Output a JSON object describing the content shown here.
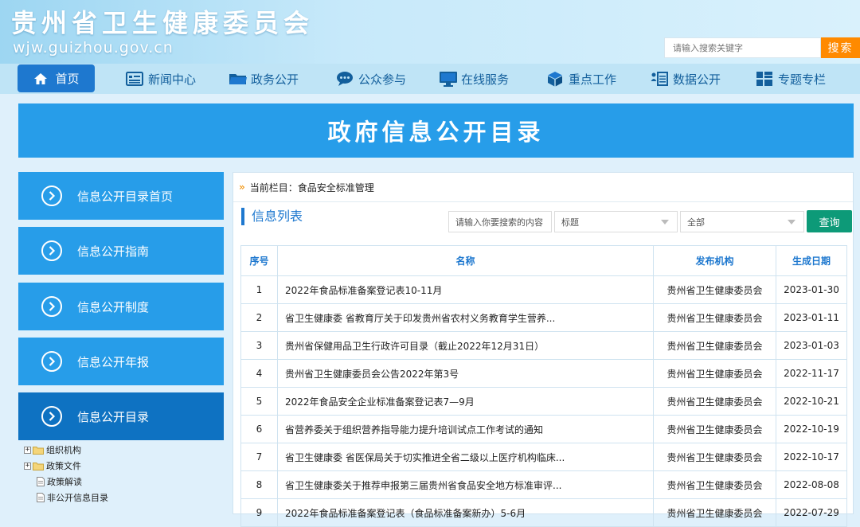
{
  "header": {
    "site_title": "贵州省卫生健康委员会",
    "site_domain": "wjw.guizhou.gov.cn",
    "search_placeholder": "请输入搜索关键字",
    "search_button": "搜索"
  },
  "nav": {
    "items": [
      {
        "label": "首页",
        "icon": "home-icon"
      },
      {
        "label": "新闻中心",
        "icon": "news-icon"
      },
      {
        "label": "政务公开",
        "icon": "folder-icon"
      },
      {
        "label": "公众参与",
        "icon": "chat-icon"
      },
      {
        "label": "在线服务",
        "icon": "monitor-icon"
      },
      {
        "label": "重点工作",
        "icon": "cube-icon"
      },
      {
        "label": "数据公开",
        "icon": "data-list-icon"
      },
      {
        "label": "专题专栏",
        "icon": "grid-icon"
      }
    ]
  },
  "page_title": "政府信息公开目录",
  "sidebar": {
    "items": [
      {
        "label": "信息公开目录首页"
      },
      {
        "label": "信息公开指南"
      },
      {
        "label": "信息公开制度"
      },
      {
        "label": "信息公开年报"
      },
      {
        "label": "信息公开目录"
      }
    ],
    "tree": [
      {
        "label": "组织机构",
        "type": "folder"
      },
      {
        "label": "政策文件",
        "type": "folder"
      },
      {
        "label": "政策解读",
        "type": "doc"
      },
      {
        "label": "非公开信息目录",
        "type": "doc"
      }
    ]
  },
  "content": {
    "breadcrumb_label": "当前栏目：食品安全标准管理",
    "list_title": "信息列表",
    "search_placeholder": "请输入你要搜索的内容",
    "field_select": "标题",
    "scope_select": "全部",
    "query_button": "查询",
    "columns": [
      "序号",
      "名称",
      "发布机构",
      "生成日期"
    ],
    "rows": [
      {
        "num": "1",
        "name": "2022年食品标准备案登记表10-11月",
        "org": "贵州省卫生健康委员会",
        "date": "2023-01-30"
      },
      {
        "num": "2",
        "name": "省卫生健康委 省教育厅关于印发贵州省农村义务教育学生营养...",
        "org": "贵州省卫生健康委员会",
        "date": "2023-01-11"
      },
      {
        "num": "3",
        "name": "贵州省保健用品卫生行政许可目录（截止2022年12月31日）",
        "org": "贵州省卫生健康委员会",
        "date": "2023-01-03"
      },
      {
        "num": "4",
        "name": "贵州省卫生健康委员会公告2022年第3号",
        "org": "贵州省卫生健康委员会",
        "date": "2022-11-17"
      },
      {
        "num": "5",
        "name": "2022年食品安全企业标准备案登记表7—9月",
        "org": "贵州省卫生健康委员会",
        "date": "2022-10-21"
      },
      {
        "num": "6",
        "name": "省营养委关于组织营养指导能力提升培训试点工作考试的通知",
        "org": "贵州省卫生健康委员会",
        "date": "2022-10-19"
      },
      {
        "num": "7",
        "name": "省卫生健康委 省医保局关于切实推进全省二级以上医疗机构临床...",
        "org": "贵州省卫生健康委员会",
        "date": "2022-10-17"
      },
      {
        "num": "8",
        "name": "省卫生健康委关于推荐申报第三届贵州省食品安全地方标准审评...",
        "org": "贵州省卫生健康委员会",
        "date": "2022-08-08"
      },
      {
        "num": "9",
        "name": "2022年食品标准备案登记表（食品标准备案新办）5-6月",
        "org": "贵州省卫生健康委员会",
        "date": "2022-07-29"
      }
    ]
  },
  "colors": {
    "accent": "#279de9",
    "accent_dark": "#0e72c2",
    "nav_bg": "#bfe4f6",
    "search_button": "#ff8a00",
    "query_button": "#0d9a78"
  }
}
